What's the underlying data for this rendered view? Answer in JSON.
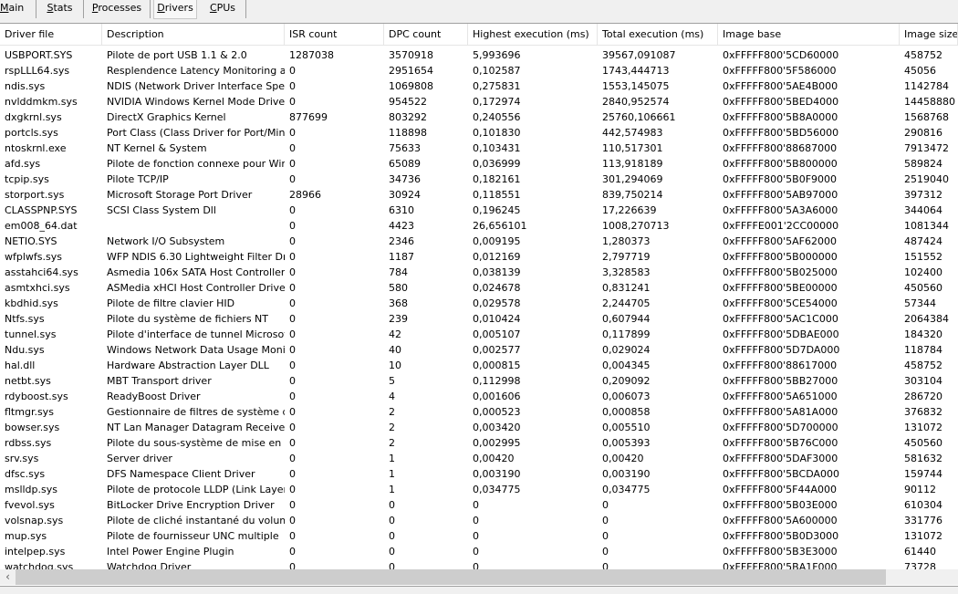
{
  "tabs": [
    {
      "label": "Main",
      "selected": false
    },
    {
      "label": "Stats",
      "selected": false
    },
    {
      "label": "Processes",
      "selected": false
    },
    {
      "label": "Drivers",
      "selected": true
    },
    {
      "label": "CPUs",
      "selected": false
    }
  ],
  "columns": [
    "Driver file",
    "Description",
    "ISR count",
    "DPC count",
    "Highest execution (ms)",
    "Total execution (ms)",
    "Image base",
    "Image size"
  ],
  "rows": [
    [
      "USBPORT.SYS",
      "Pilote de port USB 1.1 & 2.0",
      "1287038",
      "3570918",
      "5,993696",
      "39567,091087",
      "0xFFFFF800'5CD60000",
      "458752"
    ],
    [
      "rspLLL64.sys",
      "Resplendence Latency Monitoring a...",
      "0",
      "2951654",
      "0,102587",
      "1743,444713",
      "0xFFFFF800'5F586000",
      "45056"
    ],
    [
      "ndis.sys",
      "NDIS (Network Driver Interface Spe...",
      "0",
      "1069808",
      "0,275831",
      "1553,145075",
      "0xFFFFF800'5AE4B000",
      "1142784"
    ],
    [
      "nvlddmkm.sys",
      "NVIDIA Windows Kernel Mode Drive...",
      "0",
      "954522",
      "0,172974",
      "2840,952574",
      "0xFFFFF800'5BED4000",
      "14458880"
    ],
    [
      "dxgkrnl.sys",
      "DirectX Graphics Kernel",
      "877699",
      "803292",
      "0,240556",
      "25760,106661",
      "0xFFFFF800'5B8A0000",
      "1568768"
    ],
    [
      "portcls.sys",
      "Port Class (Class Driver for Port/Mini...",
      "0",
      "118898",
      "0,101830",
      "442,574983",
      "0xFFFFF800'5BD56000",
      "290816"
    ],
    [
      "ntoskrnl.exe",
      "NT Kernel & System",
      "0",
      "75633",
      "0,103431",
      "110,517301",
      "0xFFFFF800'88687000",
      "7913472"
    ],
    [
      "afd.sys",
      "Pilote de fonction connexe pour Win...",
      "0",
      "65089",
      "0,036999",
      "113,918189",
      "0xFFFFF800'5B800000",
      "589824"
    ],
    [
      "tcpip.sys",
      "Pilote TCP/IP",
      "0",
      "34736",
      "0,182161",
      "301,294069",
      "0xFFFFF800'5B0F9000",
      "2519040"
    ],
    [
      "storport.sys",
      "Microsoft Storage Port Driver",
      "28966",
      "30924",
      "0,118551",
      "839,750214",
      "0xFFFFF800'5AB97000",
      "397312"
    ],
    [
      "CLASSPNP.SYS",
      "SCSI Class System Dll",
      "0",
      "6310",
      "0,196245",
      "17,226639",
      "0xFFFFF800'5A3A6000",
      "344064"
    ],
    [
      "em008_64.dat",
      "",
      "0",
      "4423",
      "26,656101",
      "1008,270713",
      "0xFFFFE001'2CC00000",
      "1081344"
    ],
    [
      "NETIO.SYS",
      "Network I/O Subsystem",
      "0",
      "2346",
      "0,009195",
      "1,280373",
      "0xFFFFF800'5AF62000",
      "487424"
    ],
    [
      "wfplwfs.sys",
      "WFP NDIS 6.30 Lightweight Filter Dr...",
      "0",
      "1187",
      "0,012169",
      "2,797719",
      "0xFFFFF800'5B000000",
      "151552"
    ],
    [
      "asstahci64.sys",
      "Asmedia 106x SATA Host Controller ...",
      "0",
      "784",
      "0,038139",
      "3,328583",
      "0xFFFFF800'5B025000",
      "102400"
    ],
    [
      "asmtxhci.sys",
      "ASMedia xHCI Host Controller Driver",
      "0",
      "580",
      "0,024678",
      "0,831241",
      "0xFFFFF800'5BE00000",
      "450560"
    ],
    [
      "kbdhid.sys",
      "Pilote de filtre clavier HID",
      "0",
      "368",
      "0,029578",
      "2,244705",
      "0xFFFFF800'5CE54000",
      "57344"
    ],
    [
      "Ntfs.sys",
      "Pilote du système de fichiers NT",
      "0",
      "239",
      "0,010424",
      "0,607944",
      "0xFFFFF800'5AC1C000",
      "2064384"
    ],
    [
      "tunnel.sys",
      "Pilote d'interface de tunnel Microsoft",
      "0",
      "42",
      "0,005107",
      "0,117899",
      "0xFFFFF800'5DBAE000",
      "184320"
    ],
    [
      "Ndu.sys",
      "Windows Network Data Usage Monit...",
      "0",
      "40",
      "0,002577",
      "0,029024",
      "0xFFFFF800'5D7DA000",
      "118784"
    ],
    [
      "hal.dll",
      "Hardware Abstraction Layer DLL",
      "0",
      "10",
      "0,000815",
      "0,004345",
      "0xFFFFF800'88617000",
      "458752"
    ],
    [
      "netbt.sys",
      "MBT Transport driver",
      "0",
      "5",
      "0,112998",
      "0,209092",
      "0xFFFFF800'5BB27000",
      "303104"
    ],
    [
      "rdyboost.sys",
      "ReadyBoost Driver",
      "0",
      "4",
      "0,001606",
      "0,006073",
      "0xFFFFF800'5A651000",
      "286720"
    ],
    [
      "fltmgr.sys",
      "Gestionnaire de filtres de système d...",
      "0",
      "2",
      "0,000523",
      "0,000858",
      "0xFFFFF800'5A81A000",
      "376832"
    ],
    [
      "bowser.sys",
      "NT Lan Manager Datagram Receiver...",
      "0",
      "2",
      "0,003420",
      "0,005510",
      "0xFFFFF800'5D700000",
      "131072"
    ],
    [
      "rdbss.sys",
      "Pilote du sous-système de mise en ...",
      "0",
      "2",
      "0,002995",
      "0,005393",
      "0xFFFFF800'5B76C000",
      "450560"
    ],
    [
      "srv.sys",
      "Server driver",
      "0",
      "1",
      "0,00420",
      "0,00420",
      "0xFFFFF800'5DAF3000",
      "581632"
    ],
    [
      "dfsc.sys",
      "DFS Namespace Client Driver",
      "0",
      "1",
      "0,003190",
      "0,003190",
      "0xFFFFF800'5BCDA000",
      "159744"
    ],
    [
      "mslldp.sys",
      "Pilote de protocole LLDP (Link Layer ...",
      "0",
      "1",
      "0,034775",
      "0,034775",
      "0xFFFFF800'5F44A000",
      "90112"
    ],
    [
      "fvevol.sys",
      "BitLocker Drive Encryption Driver",
      "0",
      "0",
      "0",
      "0",
      "0xFFFFF800'5B03E000",
      "610304"
    ],
    [
      "volsnap.sys",
      "Pilote de cliché instantané du volume",
      "0",
      "0",
      "0",
      "0",
      "0xFFFFF800'5A600000",
      "331776"
    ],
    [
      "mup.sys",
      "Pilote de fournisseur UNC multiple",
      "0",
      "0",
      "0",
      "0",
      "0xFFFFF800'5B0D3000",
      "131072"
    ],
    [
      "intelpep.sys",
      "Intel Power Engine Plugin",
      "0",
      "0",
      "0",
      "0",
      "0xFFFFF800'5B3E3000",
      "61440"
    ],
    [
      "watchdog.sys",
      "Watchdog Driver",
      "0",
      "0",
      "0",
      "0",
      "0xFFFFF800'5BA1F000",
      "73728"
    ]
  ],
  "scrollbar": {
    "left_arrow_icon": "chevron-left-icon"
  }
}
